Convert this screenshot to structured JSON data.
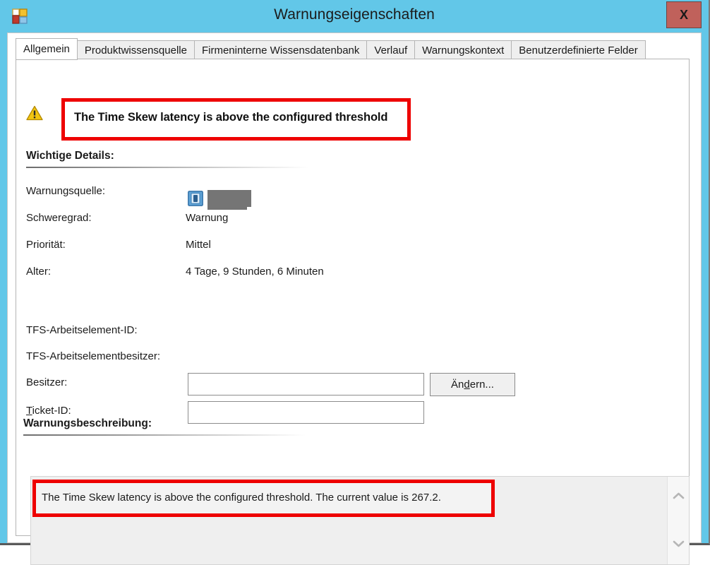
{
  "window": {
    "title": "Warnungseigenschaften",
    "app_icon": "scom-app-icon",
    "close_label": "X",
    "titlebar_color": "#62c7e8",
    "close_color": "#c0615b"
  },
  "tabs": [
    {
      "label": "Allgemein",
      "selected": true
    },
    {
      "label": "Produktwissensquelle",
      "selected": false
    },
    {
      "label": "Firmeninterne Wissensdatenbank",
      "selected": false
    },
    {
      "label": "Verlauf",
      "selected": false
    },
    {
      "label": "Warnungskontext",
      "selected": false
    },
    {
      "label": "Benutzerdefinierte Felder",
      "selected": false
    }
  ],
  "alert": {
    "icon": "warning-triangle-icon",
    "title": "The Time Skew latency is above the configured threshold",
    "highlight_color": "#ee0000"
  },
  "details": {
    "heading": "Wichtige Details:",
    "rows": [
      {
        "label": "Warnungsquelle:",
        "value": "",
        "redacted": true,
        "icon": "computer-icon"
      },
      {
        "label": "Schweregrad:",
        "value": "Warnung"
      },
      {
        "label": "Priorität:",
        "value": "Mittel"
      },
      {
        "label": "Alter:",
        "value": "4 Tage, 9 Stunden, 6 Minuten"
      }
    ]
  },
  "tfs": {
    "work_item_id_label": "TFS-Arbeitselement-ID:",
    "work_item_id_value": "",
    "work_item_owner_label": "TFS-Arbeitselementbesitzer:",
    "work_item_owner_value": "",
    "owner_label": "Besitzer:",
    "owner_value": "",
    "change_button": "Ändern...",
    "change_button_prefix": "Än",
    "change_button_accel": "d",
    "change_button_suffix": "ern...",
    "ticket_label": "Ticket-ID:",
    "ticket_accel": "T",
    "ticket_label_rest": "icket-ID:",
    "ticket_value": ""
  },
  "description": {
    "heading": "Warnungsbeschreibung:",
    "text": "The Time Skew latency is above the configured threshold. The current value is 267.2.",
    "highlight_color": "#ee0000",
    "scroll_up_icon": "chevron-up-icon",
    "scroll_down_icon": "chevron-down-icon"
  }
}
